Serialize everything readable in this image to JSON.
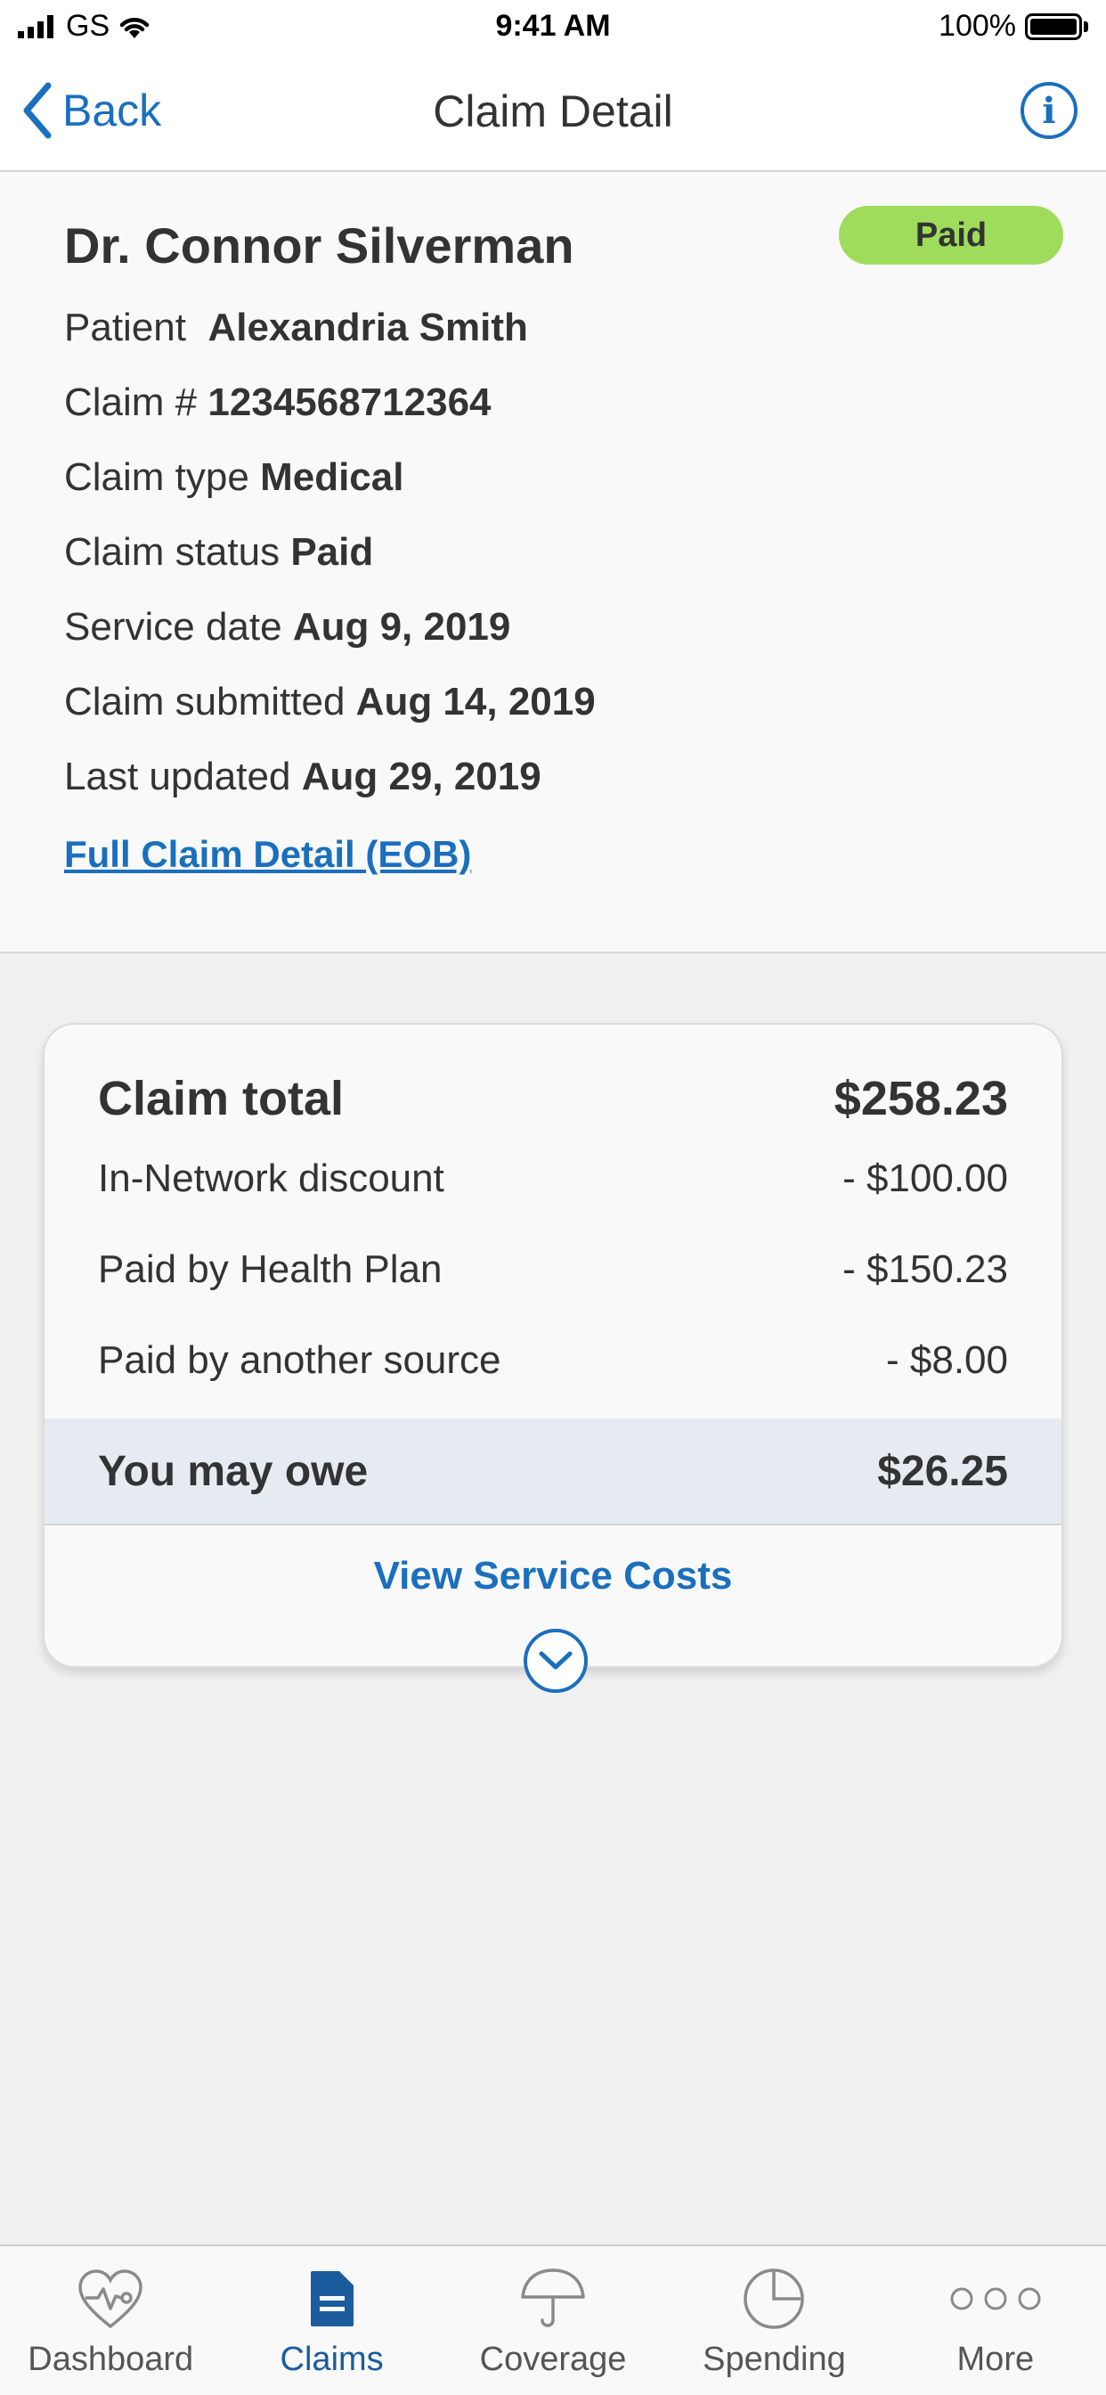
{
  "status_bar": {
    "carrier": "GS",
    "time": "9:41 AM",
    "battery": "100%"
  },
  "nav": {
    "back_label": "Back",
    "title": "Claim Detail"
  },
  "claim": {
    "provider": "Dr. Connor Silverman",
    "badge": "Paid",
    "badge_color": "#9fdc5b",
    "patient_label": "Patient",
    "patient": "Alexandria Smith",
    "claim_number_label": "Claim #",
    "claim_number": "1234568712364",
    "type_label": "Claim type",
    "type": "Medical",
    "status_label": "Claim status",
    "status": "Paid",
    "service_date_label": "Service date",
    "service_date": "Aug 9, 2019",
    "submitted_label": "Claim submitted",
    "submitted": "Aug 14, 2019",
    "updated_label": "Last updated",
    "updated": "Aug 29, 2019",
    "eob_link": "Full Claim Detail (EOB)"
  },
  "totals": {
    "total_label": "Claim total",
    "total_value": "$258.23",
    "rows": [
      {
        "label": "In-Network discount",
        "value": "- $100.00"
      },
      {
        "label": "Paid by Health Plan",
        "value": "- $150.23"
      },
      {
        "label": "Paid by another source",
        "value": "- $8.00"
      }
    ],
    "owe_label": "You may owe",
    "owe_value": "$26.25",
    "view_costs": "View Service Costs"
  },
  "tabs": [
    {
      "label": "Dashboard",
      "icon": "heart-pulse-icon"
    },
    {
      "label": "Claims",
      "icon": "document-icon",
      "active": true
    },
    {
      "label": "Coverage",
      "icon": "umbrella-icon"
    },
    {
      "label": "Spending",
      "icon": "pie-chart-icon"
    },
    {
      "label": "More",
      "icon": "more-dots-icon"
    }
  ],
  "colors": {
    "accent": "#1a6fbe",
    "active_tab": "#1a5c9e",
    "owe_band": "#e6ebf1"
  }
}
